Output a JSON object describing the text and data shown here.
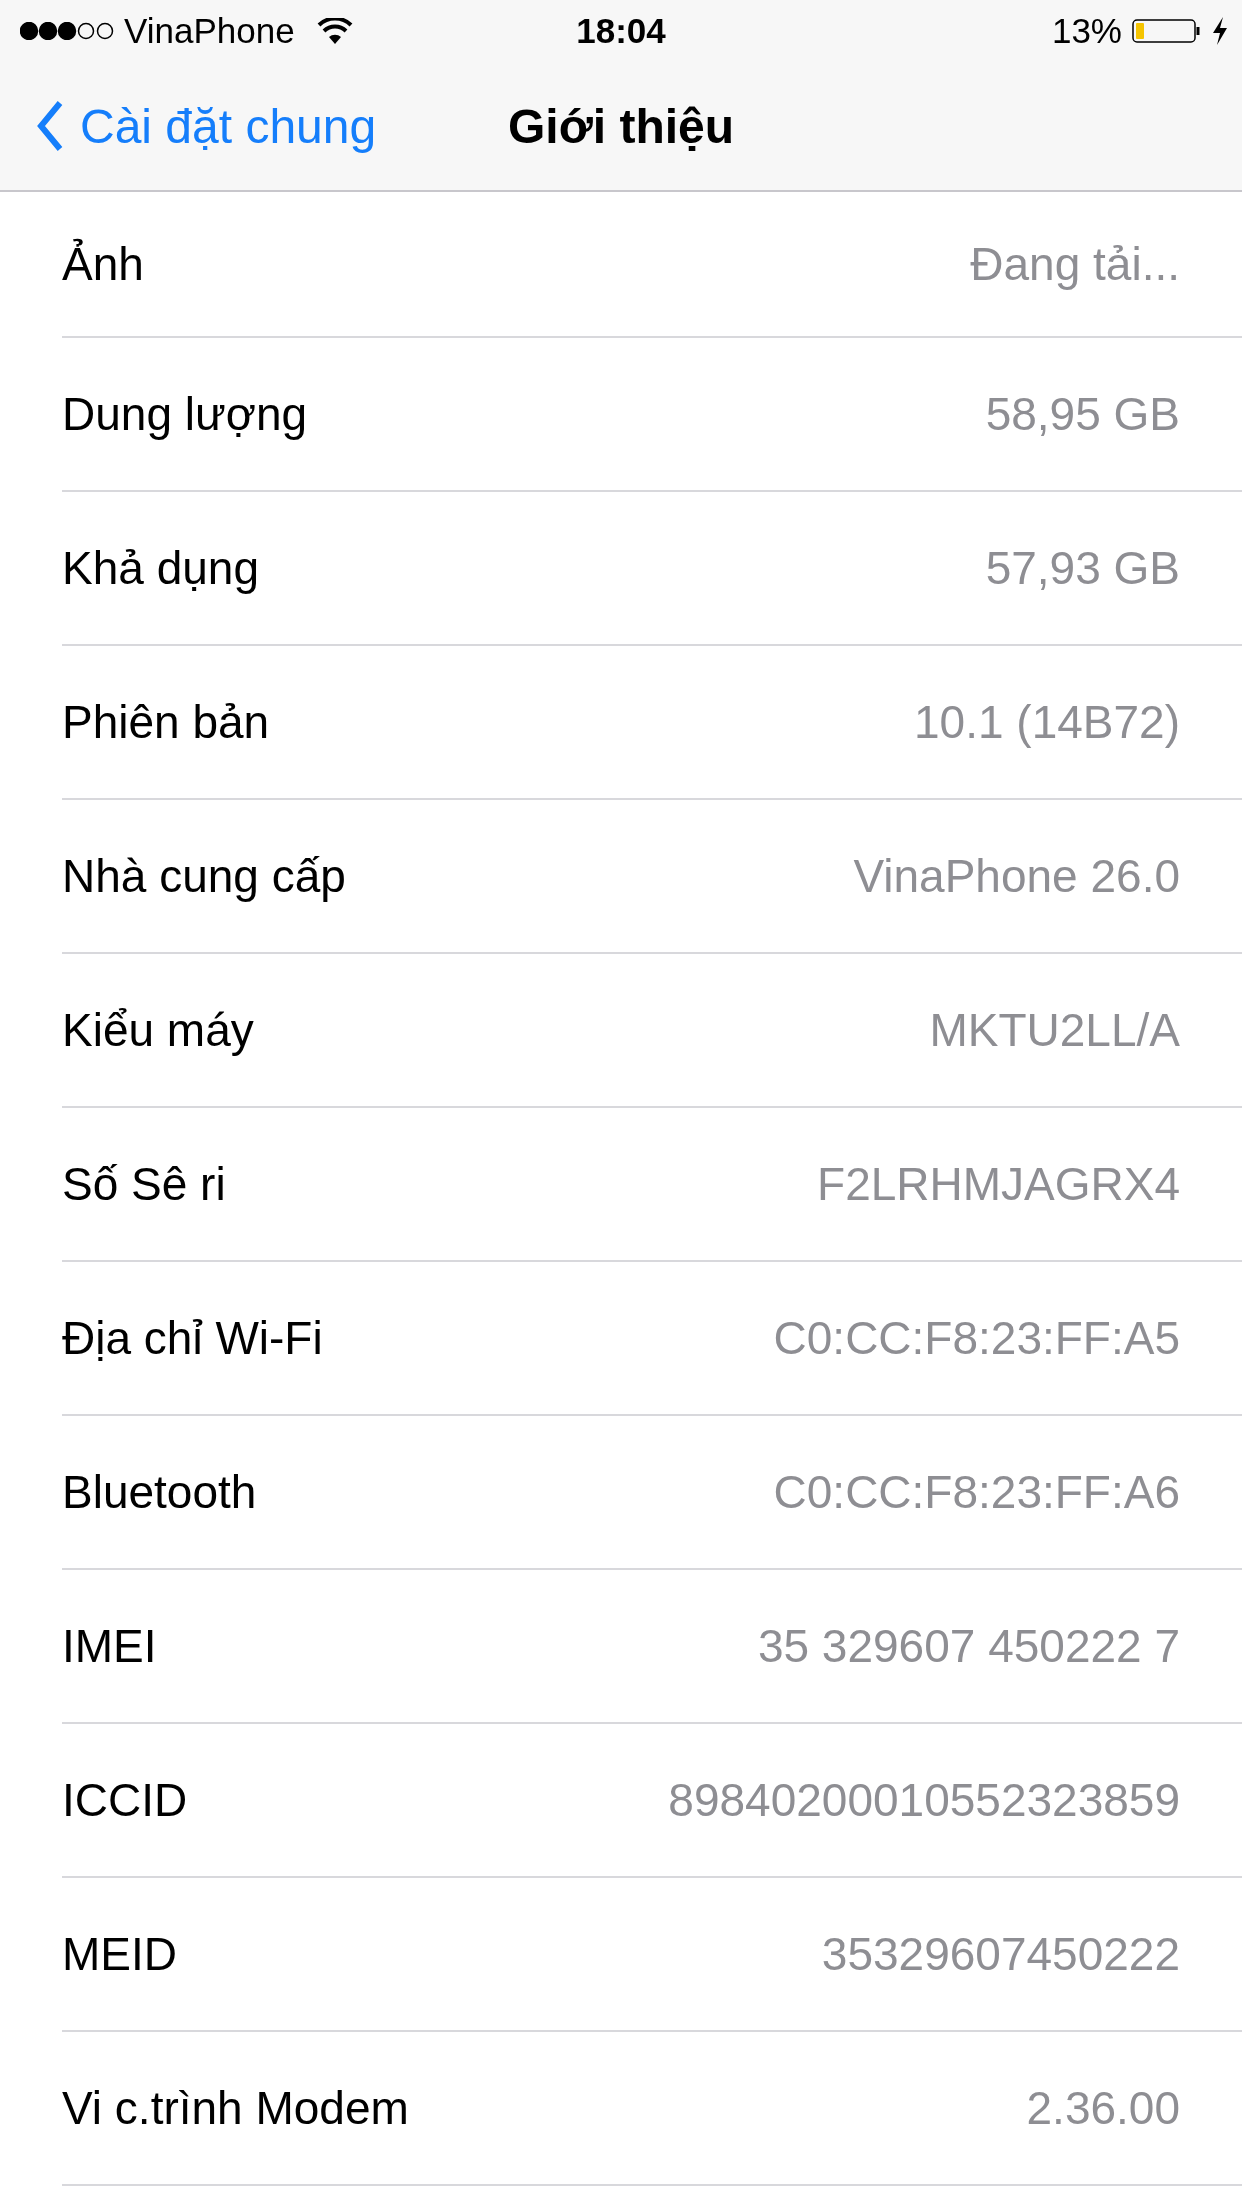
{
  "status_bar": {
    "carrier": "VinaPhone",
    "time": "18:04",
    "battery": "13%"
  },
  "nav_bar": {
    "back": "Cài đặt chung",
    "title": "Giới thiệu"
  },
  "rows": [
    {
      "label": "Ảnh",
      "value": "Đang tải..."
    },
    {
      "label": "Dung lượng",
      "value": "58,95 GB"
    },
    {
      "label": "Khả dụng",
      "value": "57,93 GB"
    },
    {
      "label": "Phiên bản",
      "value": "10.1 (14B72)"
    },
    {
      "label": "Nhà cung cấp",
      "value": "VinaPhone 26.0"
    },
    {
      "label": "Kiểu máy",
      "value": "MKTU2LL/A"
    },
    {
      "label": "Số Sê ri",
      "value": "F2LRHMJAGRX4"
    },
    {
      "label": "Địa chỉ Wi-Fi",
      "value": "C0:CC:F8:23:FF:A5"
    },
    {
      "label": "Bluetooth",
      "value": "C0:CC:F8:23:FF:A6"
    },
    {
      "label": "IMEI",
      "value": "35 329607 450222 7"
    },
    {
      "label": "ICCID",
      "value": "89840200010552323859"
    },
    {
      "label": "MEID",
      "value": "35329607450222"
    },
    {
      "label": "Vi c.trình Modem",
      "value": "2.36.00"
    }
  ]
}
